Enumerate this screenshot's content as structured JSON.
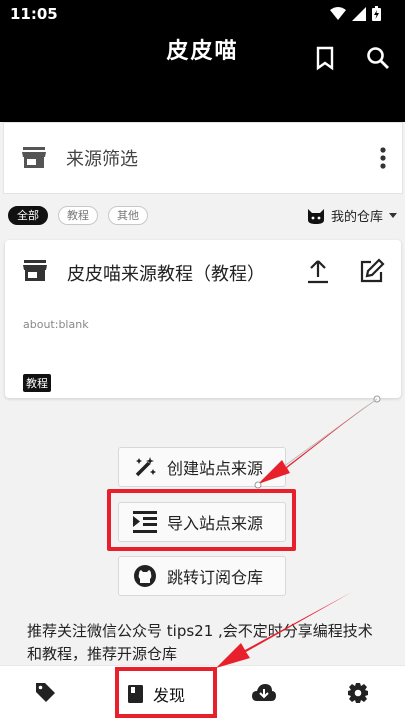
{
  "status": {
    "time": "11:05"
  },
  "app": {
    "title": "皮皮喵"
  },
  "filter": {
    "label": "来源筛选"
  },
  "chips": [
    "全部",
    "教程",
    "其他"
  ],
  "repo": {
    "label": "我的仓库"
  },
  "card": {
    "name": "皮皮喵来源教程（教程）",
    "url": "about:blank",
    "tag": "教程"
  },
  "actions": {
    "create": "创建站点来源",
    "import": "导入站点来源",
    "jump": "跳转订阅仓库"
  },
  "note": "推荐关注微信公众号 tips21 ,会不定时分享编程技术和教程，推荐开源仓库",
  "nav": {
    "discover": "发现"
  },
  "colors": {
    "highlight": "#e8202b",
    "bar": "#000000"
  },
  "icons": [
    "wifi-icon",
    "signal-icon",
    "battery-icon",
    "bookmark-icon",
    "search-icon",
    "store-icon",
    "more-vert-icon",
    "cat-icon",
    "upload-icon",
    "edit-icon",
    "magic-icon",
    "import-icon",
    "github-icon",
    "tag-icon",
    "book-icon",
    "cloud-download-icon",
    "gear-icon"
  ]
}
